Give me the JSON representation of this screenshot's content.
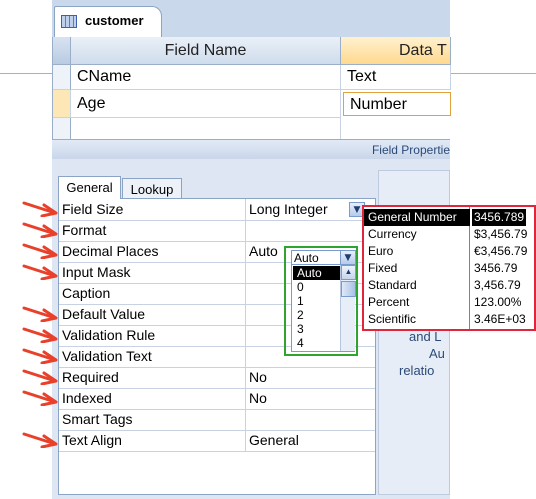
{
  "table_tab": {
    "label": "customer"
  },
  "grid": {
    "headers": {
      "field_name": "Field Name",
      "data_type": "Data T"
    },
    "rows": [
      {
        "name": "CName",
        "type": "Text"
      },
      {
        "name": "Age",
        "type": "Number"
      }
    ]
  },
  "properties_bar": {
    "label": "Field Propertie"
  },
  "property_tabs": [
    {
      "label": "General"
    },
    {
      "label": "Lookup"
    }
  ],
  "properties": [
    {
      "name": "Field Size",
      "value": "Long Integer"
    },
    {
      "name": "Format",
      "value": ""
    },
    {
      "name": "Decimal Places",
      "value": "Auto"
    },
    {
      "name": "Input Mask",
      "value": ""
    },
    {
      "name": "Caption",
      "value": ""
    },
    {
      "name": "Default Value",
      "value": ""
    },
    {
      "name": "Validation Rule",
      "value": ""
    },
    {
      "name": "Validation Text",
      "value": ""
    },
    {
      "name": "Required",
      "value": "No"
    },
    {
      "name": "Indexed",
      "value": "No"
    },
    {
      "name": "Smart Tags",
      "value": ""
    },
    {
      "name": "Text Align",
      "value": "General"
    }
  ],
  "help_text": {
    "line1": "and L",
    "line2": "Au",
    "line3": "relatio"
  },
  "decimal_dropdown": {
    "current": "Auto",
    "options": [
      "Auto",
      "0",
      "1",
      "2",
      "3",
      "4"
    ],
    "selected_index": 0
  },
  "format_dropdown": {
    "options": [
      {
        "name": "General Number",
        "example": "3456.789"
      },
      {
        "name": "Currency",
        "example": "$3,456.79"
      },
      {
        "name": "Euro",
        "example": "€3,456.79"
      },
      {
        "name": "Fixed",
        "example": "3456.79"
      },
      {
        "name": "Standard",
        "example": "3,456.79"
      },
      {
        "name": "Percent",
        "example": "123.00%"
      },
      {
        "name": "Scientific",
        "example": "3.46E+03"
      }
    ],
    "selected_index": 0
  },
  "icons": {
    "table": "table-icon",
    "dropdown": "chevron-down-icon",
    "scroll_up": "scroll-up-arrow-icon",
    "annotation": "red-arrow-icon"
  },
  "colors": {
    "annotation_arrow": "#e8402a",
    "highlight_green": "#2fa42f",
    "highlight_red": "#e0263a",
    "selected_row": "#fde7b6"
  }
}
